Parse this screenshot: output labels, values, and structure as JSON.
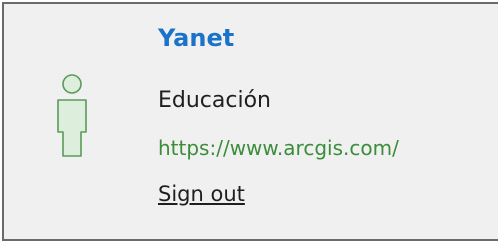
{
  "account": {
    "user_name": "Yanet",
    "organization": "Educación",
    "portal_url": "https://www.arcgis.com/",
    "sign_out_label": "Sign out",
    "avatar_icon": "user-icon"
  },
  "colors": {
    "user_name": "#1a73c8",
    "portal_url": "#3b8d3b",
    "avatar_fill": "#ddeedd",
    "avatar_stroke": "#5a9a5a",
    "panel_background": "#f0f0f0",
    "panel_border": "#6a6a6a"
  }
}
